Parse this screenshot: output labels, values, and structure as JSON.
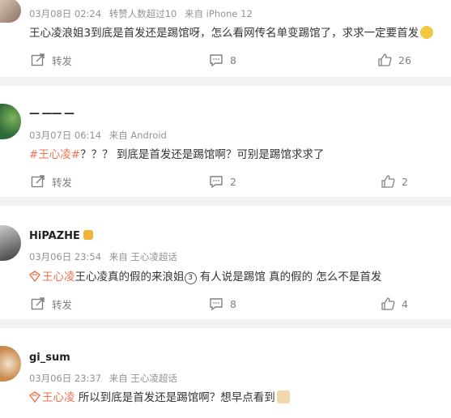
{
  "actions": {
    "repost_label": "转发"
  },
  "posts": [
    {
      "meta": {
        "date": "03月08日 02:24",
        "extra": "转赞人数超过10",
        "source": "来自 iPhone 12"
      },
      "text": "王心凌浪姐3到底是首发还是踢馆呀，怎么看网传名单变踢馆了，求求一定要首发",
      "comments": "8",
      "likes": "26"
    },
    {
      "user": "— —— —",
      "meta": {
        "date": "03月07日 06:14",
        "source": "来自 Android"
      },
      "topic": "#王心凌#",
      "text": "？？？ 到底是首发还是踢馆啊？可别是踢馆求求了",
      "comments": "2",
      "likes": "2"
    },
    {
      "user": "HiPAZHE",
      "meta": {
        "date": "03月06日 23:54",
        "source": "来自 王心凌超话"
      },
      "topic": "王心凌",
      "text_a": "王心凌真的假的来浪姐",
      "num": "3",
      "text_b": " 有人说是踢馆 真的假的 怎么不是首发",
      "comments": "8",
      "likes": "4"
    },
    {
      "user": "gi_sum",
      "meta": {
        "date": "03月06日 23:37",
        "source": "来自 王心凌超话"
      },
      "topic": "王心凌",
      "text": " 所以到底是首发还是踢馆啊？想早点看到"
    }
  ],
  "colors": {
    "topic": "#eb7350",
    "meta": "#939393",
    "separator": "#f2f2f5",
    "action": "#808080"
  },
  "icons": [
    "repost-icon",
    "comment-icon",
    "like-icon",
    "super-topic-icon",
    "emoji-icon",
    "avatar"
  ]
}
